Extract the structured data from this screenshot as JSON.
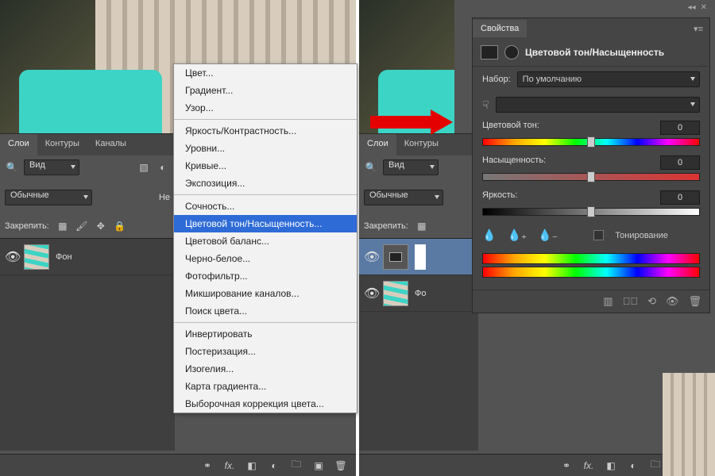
{
  "tabs": {
    "layers": "Слои",
    "paths": "Контуры",
    "channels": "Каналы"
  },
  "search": {
    "label": "Вид"
  },
  "blend": {
    "mode": "Обычные",
    "opacity_prefix": "Не"
  },
  "lock": {
    "label": "Закрепить:"
  },
  "layer_bg": "Фон",
  "context_menu": {
    "g1": [
      "Цвет...",
      "Градиент...",
      "Узор..."
    ],
    "g2": [
      "Яркость/Контрастность...",
      "Уровни...",
      "Кривые...",
      "Экспозиция..."
    ],
    "g3": [
      "Сочность...",
      "Цветовой тон/Насыщенность...",
      "Цветовой баланс...",
      "Черно-белое...",
      "Фотофильтр...",
      "Микширование каналов...",
      "Поиск цвета..."
    ],
    "g4": [
      "Инвертировать",
      "Постеризация...",
      "Изогелия...",
      "Карта градиента...",
      "Выборочная коррекция цвета..."
    ],
    "highlight_index_g3": 1
  },
  "properties": {
    "tab": "Свойства",
    "title": "Цветовой тон/Насыщенность",
    "preset_label": "Набор:",
    "preset_value": "По умолчанию",
    "hue": {
      "label": "Цветовой тон:",
      "value": "0"
    },
    "sat": {
      "label": "Насыщенность:",
      "value": "0"
    },
    "lig": {
      "label": "Яркость:",
      "value": "0"
    },
    "colorize": "Тонирование"
  },
  "right_layers": {
    "bg": "Фо"
  }
}
